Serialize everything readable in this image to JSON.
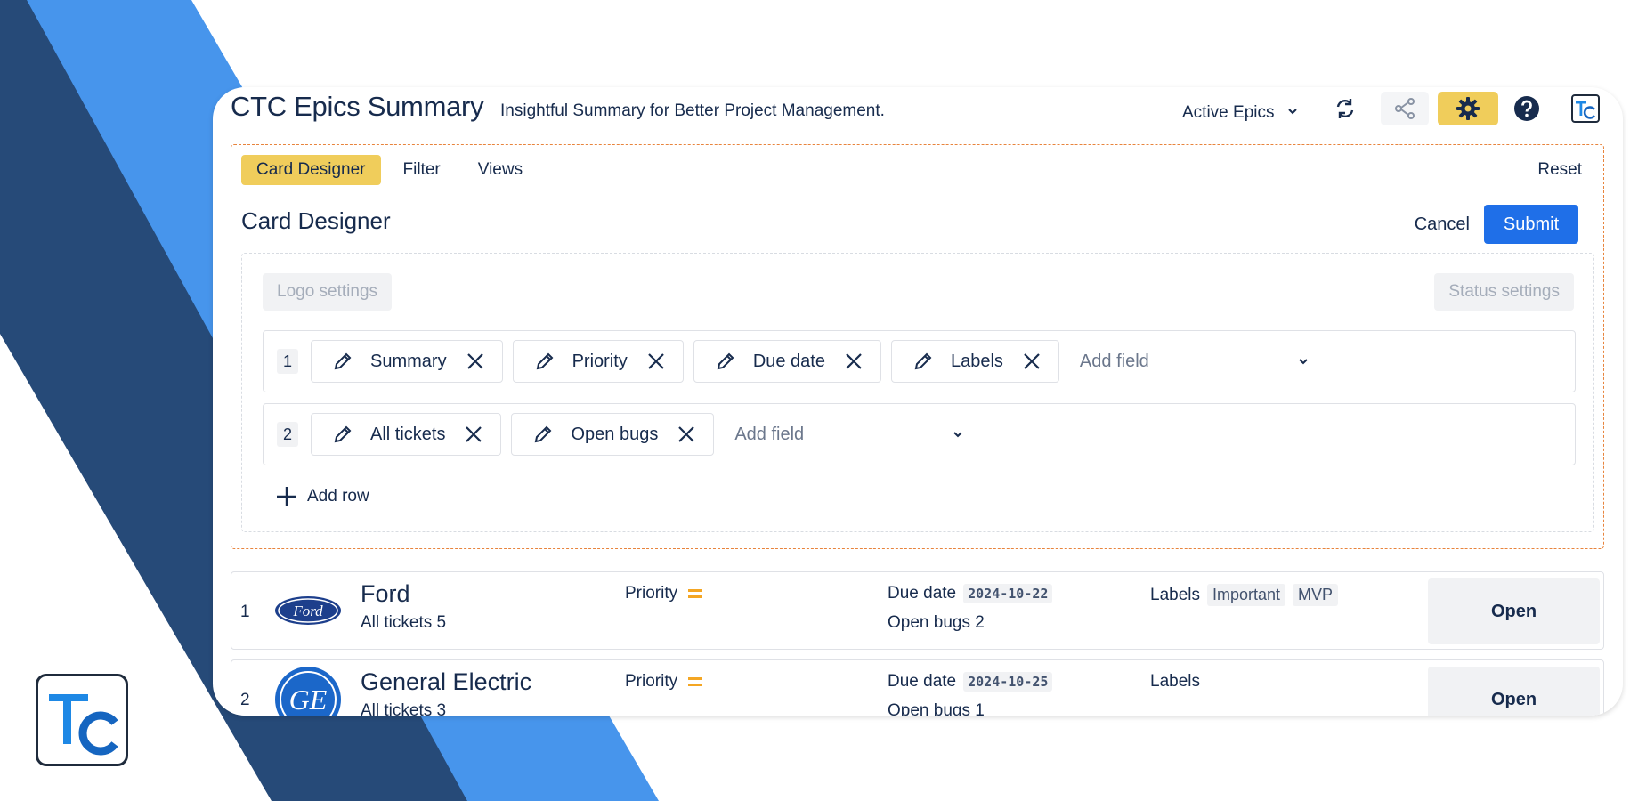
{
  "header": {
    "title": "CTC Epics Summary",
    "subtitle": "Insightful Summary for Better Project Management.",
    "view_select": "Active Epics",
    "icons": [
      "refresh-icon",
      "share-icon",
      "gear-icon",
      "help-icon",
      "tc-logo-icon"
    ]
  },
  "tabs": [
    {
      "label": "Card Designer",
      "active": true
    },
    {
      "label": "Filter",
      "active": false
    },
    {
      "label": "Views",
      "active": false
    }
  ],
  "reset_label": "Reset",
  "designer": {
    "title": "Card Designer",
    "cancel_label": "Cancel",
    "submit_label": "Submit",
    "logo_settings_label": "Logo settings",
    "status_settings_label": "Status settings",
    "rows": [
      {
        "number": "1",
        "fields": [
          "Summary",
          "Priority",
          "Due date",
          "Labels"
        ],
        "add_field_placeholder": "Add field"
      },
      {
        "number": "2",
        "fields": [
          "All tickets",
          "Open bugs"
        ],
        "add_field_placeholder": "Add field"
      }
    ],
    "add_row_label": "Add row"
  },
  "cards": [
    {
      "number": "1",
      "logo": "ford-logo",
      "name": "Ford",
      "tickets_label": "All tickets 5",
      "priority_label": "Priority",
      "due_label": "Due date",
      "due_date": "2024-10-22",
      "bugs_label": "Open bugs 2",
      "labels_label": "Labels",
      "labels": [
        "Important",
        "MVP"
      ],
      "open_label": "Open"
    },
    {
      "number": "2",
      "logo": "general-electric-logo",
      "name": "General Electric",
      "tickets_label": "All tickets 3",
      "priority_label": "Priority",
      "due_label": "Due date",
      "due_date": "2024-10-25",
      "bugs_label": "Open bugs 1",
      "labels_label": "Labels",
      "labels": [],
      "open_label": "Open"
    }
  ],
  "colors": {
    "accent_yellow": "#f0cd5b",
    "primary_blue": "#1f6fe8",
    "dashed_orange": "#e8843d",
    "priority_orange": "#f4a623",
    "bg_dark_blue": "#264a78",
    "bg_light_blue": "#4795ec"
  }
}
